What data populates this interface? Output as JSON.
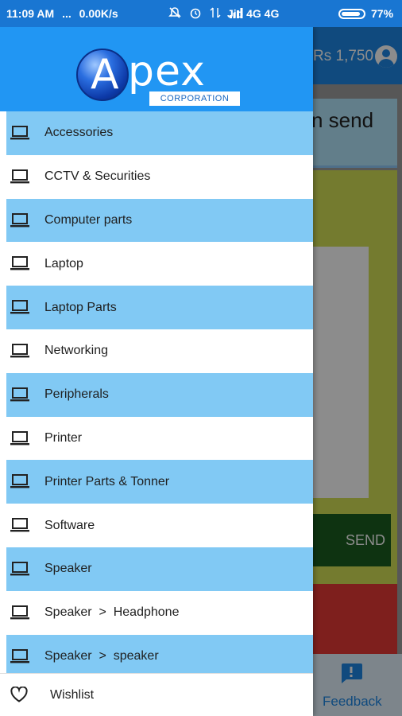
{
  "status_bar": {
    "time": "11:09 AM",
    "dots": "...",
    "speed": "0.00K/s",
    "network": "Jio 4G 4G",
    "battery": "77%",
    "battery_level": 0.77
  },
  "background_app": {
    "balance": "Rs 1,750",
    "notice_text": "n send",
    "send_label": "SEND",
    "feedback_label": "Feedback"
  },
  "drawer": {
    "logo": {
      "letter": "A",
      "rest": "pex",
      "subtitle": "CORPORATION"
    },
    "items": [
      {
        "label": "Accessories",
        "icon": "laptop-icon"
      },
      {
        "label": "CCTV & Securities",
        "icon": "laptop-icon"
      },
      {
        "label": "Computer parts",
        "icon": "laptop-icon"
      },
      {
        "label": "Laptop",
        "icon": "laptop-icon"
      },
      {
        "label": "Laptop Parts",
        "icon": "laptop-icon"
      },
      {
        "label": "Networking",
        "icon": "laptop-icon"
      },
      {
        "label": "Peripherals",
        "icon": "laptop-icon"
      },
      {
        "label": "Printer",
        "icon": "laptop-icon"
      },
      {
        "label": "Printer Parts & Tonner",
        "icon": "laptop-icon"
      },
      {
        "label": "Software",
        "icon": "laptop-icon"
      },
      {
        "label": "Speaker",
        "icon": "laptop-icon"
      },
      {
        "label": "Speaker  >  Headphone",
        "icon": "laptop-icon"
      },
      {
        "label": "Speaker  >  speaker",
        "icon": "laptop-icon"
      }
    ],
    "wishlist_label": "Wishlist"
  },
  "colors": {
    "status_bar": "#1976d2",
    "drawer_header": "#2196f3",
    "item_highlight": "#81c9f4",
    "toolbar": "#1e88e5"
  }
}
